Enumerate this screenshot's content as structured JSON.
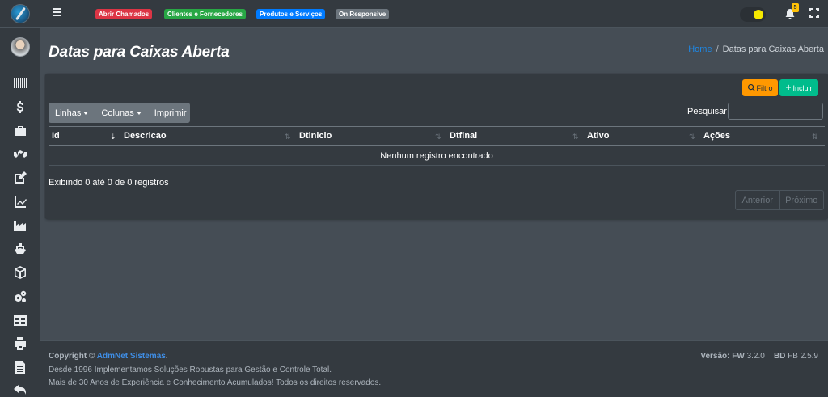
{
  "navbar": {
    "badges": [
      {
        "label": "Abrir Chamados",
        "color": "#dc3545"
      },
      {
        "label": "Clientes e Fornecedores",
        "color": "#28a745"
      },
      {
        "label": "Produtos e Serviços",
        "color": "#007bff"
      },
      {
        "label": "On Responsive",
        "color": "#6c757d"
      }
    ],
    "notification_count": "5",
    "accent_toggle": "#f6e900"
  },
  "sidebar": {
    "icons": [
      "barcode-icon",
      "dollar-icon",
      "briefcase-icon",
      "handshake-icon",
      "edit-icon",
      "chart-line-icon",
      "industry-icon",
      "ship-icon",
      "box-icon",
      "cogs-icon",
      "table-icon",
      "print-icon",
      "file-icon",
      "undo-icon"
    ]
  },
  "header": {
    "title": "Datas para Caixas Aberta",
    "breadcrumb_home": "Home",
    "breadcrumb_sep": "/",
    "breadcrumb_current": "Datas para Caixas Aberta"
  },
  "toolbar": {
    "filter_label": "Filtro",
    "add_label": "Incluir",
    "rows_label": "Linhas",
    "columns_label": "Colunas",
    "print_label": "Imprimir",
    "search_label": "Pesquisar",
    "search_value": ""
  },
  "table": {
    "columns": [
      "Id",
      "Descricao",
      "Dtinicio",
      "Dtfinal",
      "Ativo",
      "Ações"
    ],
    "empty_message": "Nenhum registro encontrado"
  },
  "pagination": {
    "info": "Exibindo 0 até 0 de 0 registros",
    "prev_label": "Anterior",
    "next_label": "Próximo"
  },
  "footer": {
    "copyright_prefix": "Copyright ©",
    "company": "AdmNet Sistemas",
    "copyright_suffix": ".",
    "line2": "Desde 1996 Implementamos Soluções Robustas para Gestão e Controle Total.",
    "line3": "Mais de 30 Anos de Experiência e Conhecimento Acumulados! Todos os direitos reservados.",
    "version_label": "Versão:",
    "fw_label": "FW",
    "fw_version": "3.2.0",
    "bd_label": "BD",
    "bd_version": "FB 2.5.9"
  },
  "colors": {
    "accent_blue": "#1e88e5",
    "filter_orange": "#ff9800",
    "add_green": "#00bc8c"
  }
}
